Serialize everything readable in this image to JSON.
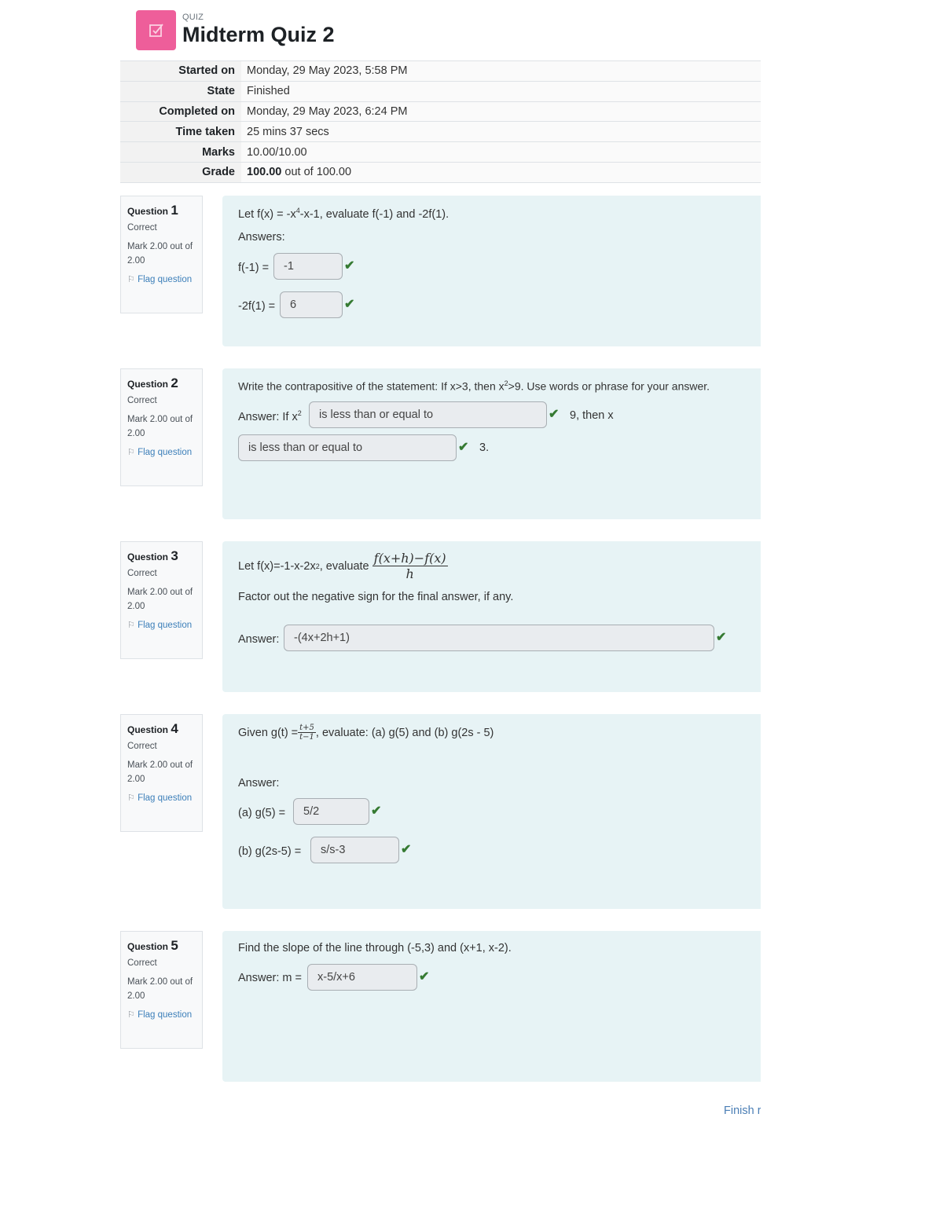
{
  "header": {
    "kicker": "QUIZ",
    "title": "Midterm Quiz 2",
    "icon": "quiz-checkbox-icon",
    "icon_color": "#ee5e9a"
  },
  "summary": [
    {
      "label": "Started on",
      "value": "Monday, 29 May 2023, 5:58 PM"
    },
    {
      "label": "State",
      "value": "Finished"
    },
    {
      "label": "Completed on",
      "value": "Monday, 29 May 2023, 6:24 PM"
    },
    {
      "label": "Time taken",
      "value": "25 mins 37 secs"
    },
    {
      "label": "Marks",
      "value": "10.00/10.00"
    },
    {
      "label": "Grade",
      "value_bold": "100.00",
      "value": " out of 100.00"
    }
  ],
  "questions": [
    {
      "label": "Question",
      "number": "1",
      "state": "Correct",
      "mark": "Mark 2.00 out of 2.00",
      "flag": "Flag question",
      "text": "Let f(x) = -x",
      "text_sup": "4",
      "text_after": "-x-1, evaluate f(-1) and -2f(1).",
      "answers_label": "Answers:",
      "answers": [
        {
          "prefix": "f(-1) =",
          "value": "-1",
          "correct": true
        },
        {
          "prefix": "-2f(1) =",
          "value": "6",
          "correct": true
        }
      ]
    },
    {
      "label": "Question",
      "number": "2",
      "state": "Correct",
      "mark": "Mark 2.00 out of 2.00",
      "flag": "Flag question",
      "text": "Write the contrapositive of the statement: If x>3, then x",
      "text_sup": "2",
      "text_after": ">9.  Use words or phrase for your answer.",
      "answer_prefix": "Answer: If x",
      "answer_prefix_sup": "2",
      "answers": [
        {
          "value": "is less than or equal to",
          "suffix": "9, then x",
          "correct": true
        },
        {
          "value": "is less than or equal to",
          "suffix": "3.",
          "correct": true
        }
      ]
    },
    {
      "label": "Question",
      "number": "3",
      "state": "Correct",
      "mark": "Mark 2.00 out of 2.00",
      "flag": "Flag question",
      "text": "Let f(x)=-1-x-2x",
      "text_sup": "2",
      "text_after": ", evaluate",
      "fraction_num": "f(x+h)−f(x)",
      "fraction_den": "h",
      "instruction": "Factor out the negative sign for the final answer, if any.",
      "answer_prefix": "Answer:",
      "answers": [
        {
          "value": "-(4x+2h+1)",
          "correct": true
        }
      ]
    },
    {
      "label": "Question",
      "number": "4",
      "state": "Correct",
      "mark": "Mark 2.00 out of 2.00",
      "flag": "Flag question",
      "text": "Given g(t) = ",
      "fraction_num": "t+5",
      "fraction_den": "t−1",
      "text_after": ", evaluate: (a) g(5) and (b) g(2s - 5)",
      "answers_label": "Answer:",
      "answers": [
        {
          "prefix": "(a)  g(5) =",
          "value": "5/2",
          "correct": true
        },
        {
          "prefix": "(b)  g(2s-5) =",
          "value": "s/s-3",
          "correct": true
        }
      ]
    },
    {
      "label": "Question",
      "number": "5",
      "state": "Correct",
      "mark": "Mark 2.00 out of 2.00",
      "flag": "Flag question",
      "text": "Find the slope of the line through (-5,3) and (x+1, x-2).",
      "answers": [
        {
          "prefix": "Answer: m =",
          "value": "x-5/x+6",
          "correct": true
        }
      ]
    }
  ],
  "footer": {
    "finish_link": "Finish review"
  },
  "colors": {
    "correct": "#357a32",
    "link": "#3c7fb9",
    "content_bg": "#e7f3f5"
  }
}
